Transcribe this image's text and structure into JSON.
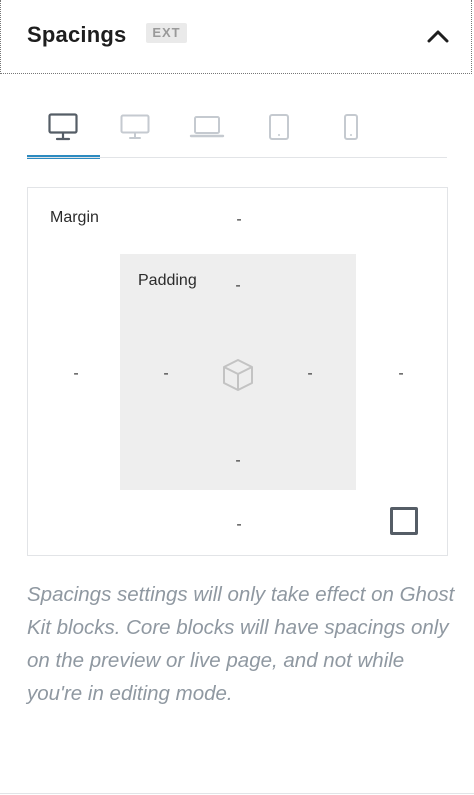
{
  "panel": {
    "title": "Spacings",
    "badge": "EXT",
    "collapse_icon": "chevron-up-icon"
  },
  "devices": {
    "active_index": 0,
    "tabs": [
      {
        "icon": "desktop-icon"
      },
      {
        "icon": "desktop-small-icon"
      },
      {
        "icon": "laptop-icon"
      },
      {
        "icon": "tablet-icon"
      },
      {
        "icon": "mobile-icon"
      }
    ]
  },
  "spacing": {
    "margin_label": "Margin",
    "padding_label": "Padding",
    "margin": {
      "top": "-",
      "right": "-",
      "bottom": "-",
      "left": "-"
    },
    "padding": {
      "top": "-",
      "right": "-",
      "bottom": "-",
      "left": "-"
    },
    "center_icon": "cube-icon",
    "link_toggle_checked": false
  },
  "help_text": "Spacings settings will only take effect on Ghost Kit blocks. Core blocks will have spacings only on the preview or live page, and not while you're in editing mode.",
  "colors": {
    "active_tab": "#2e8bc0",
    "help_text": "#8f98a1",
    "padding_bg": "#eeeeee"
  }
}
